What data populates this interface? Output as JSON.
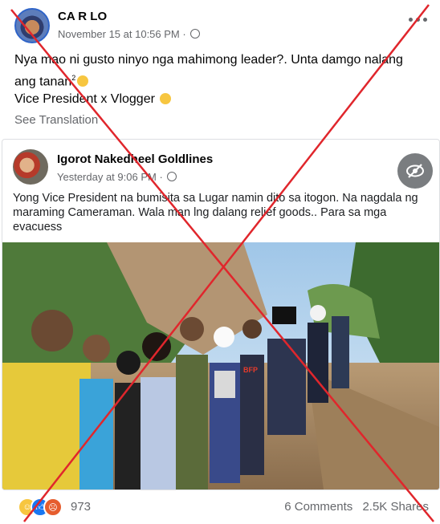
{
  "post": {
    "author": "CA R LO",
    "timestamp": "November 15 at 10:56 PM",
    "privacy_sep": "·",
    "text_line1": "Nya mao ni gusto ninyo nga mahimong leader?. Unta damgo nalang",
    "text_line2": "ang tanan",
    "text_line2_sup": "2",
    "text_line3": "Vice President x Vlogger",
    "see_translation": "See Translation"
  },
  "shared": {
    "author": "Igorot Nakedheel Goldlines",
    "timestamp": "Yesterday at 9:06 PM",
    "privacy_sep": "·",
    "text": "Yong Vice President na bumisita sa Lugar namin dito sa itogon. Na nagdala ng maraming Cameraman. Wala man lng dalang relief goods.. Para sa mga evacuess",
    "vest_text": "BFP"
  },
  "footer": {
    "reaction_count": "973",
    "comments": "6 Comments",
    "shares": "2.5K Shares"
  },
  "icons": {
    "privacy": "globe-icon",
    "hidden": "eye-slash-icon",
    "reactions": [
      "haha-reaction-icon",
      "like-reaction-icon",
      "angry-reaction-icon"
    ]
  },
  "colors": {
    "cross_mark": "#e0262c",
    "link_blue": "#1877f2",
    "secondary_text": "#65676b"
  }
}
